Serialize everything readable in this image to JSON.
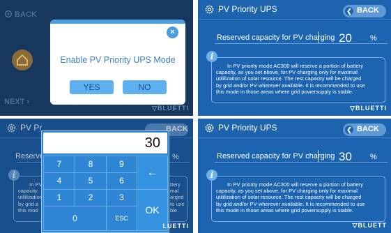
{
  "panel1": {
    "side_back": "BACK",
    "side_next": "NEXT",
    "dialog_prompt": "Enable PV Priority UPS Mode",
    "yes_label": "YES",
    "no_label": "NO",
    "close_glyph": "×",
    "logo": "BLUETTI",
    "icons": [
      "gear-icon",
      "home-icon",
      "close-icon"
    ]
  },
  "panel2": {
    "title": "PV Priority UPS",
    "back_label": "BACK",
    "back_glyph": "❮",
    "reserved_label": "Reserved capacity for PV charging",
    "reserved_value": "20",
    "unit": "%",
    "info_glyph": "i",
    "info_lines": [
      "In PV priority mode AC300 will reserve a portion of battery",
      "capacity, as you set above, for PV charging only for maximal",
      "utililization of solar resource. The rest capacity will be charged",
      "by grid and/or PV wherever available. It is recommended to use",
      "this mode in those areas where grid powersupply is stable."
    ],
    "logo": "BLUETTI"
  },
  "panel3": {
    "title_partial": "PV Pr",
    "back_partial": "BACK",
    "reserved_partial": "Reserve",
    "unit": "%",
    "left_text": [
      "In PV",
      "capacity",
      "utililization",
      "by grid a",
      "this mod"
    ],
    "right_text": [
      "ttery",
      "mal",
      "arged",
      "to use",
      "ble."
    ],
    "keypad": {
      "display": "30",
      "keys": [
        "7",
        "8",
        "9",
        "4",
        "5",
        "6",
        "1",
        "2",
        "3",
        "0",
        "ESC"
      ],
      "backspace_glyph": "←",
      "ok_label": "OK"
    },
    "logo": "LUETTI"
  },
  "panel4": {
    "title": "PV Priority UPS",
    "back_label": "BACK",
    "back_glyph": "❮",
    "reserved_label": "Reserved capacity for PV charging",
    "reserved_value": "30",
    "unit": "%",
    "info_glyph": "i",
    "info_lines": [
      "In PV priority mode AC300 will reserve a portion of battery",
      "capacity, as you set above, for PV charging only for maximal",
      "utililization of solar resource. The rest capacity will be charged",
      "by grid and/or PV wherever available. It is recommended to use",
      "this mode in those areas where grid powersupply is stable."
    ],
    "logo": "BLUETT"
  },
  "colors": {
    "screen_blue": "#1c64b0",
    "dialog_accent": "#4d9ee0",
    "keypad_blue": "#2f86d4"
  }
}
